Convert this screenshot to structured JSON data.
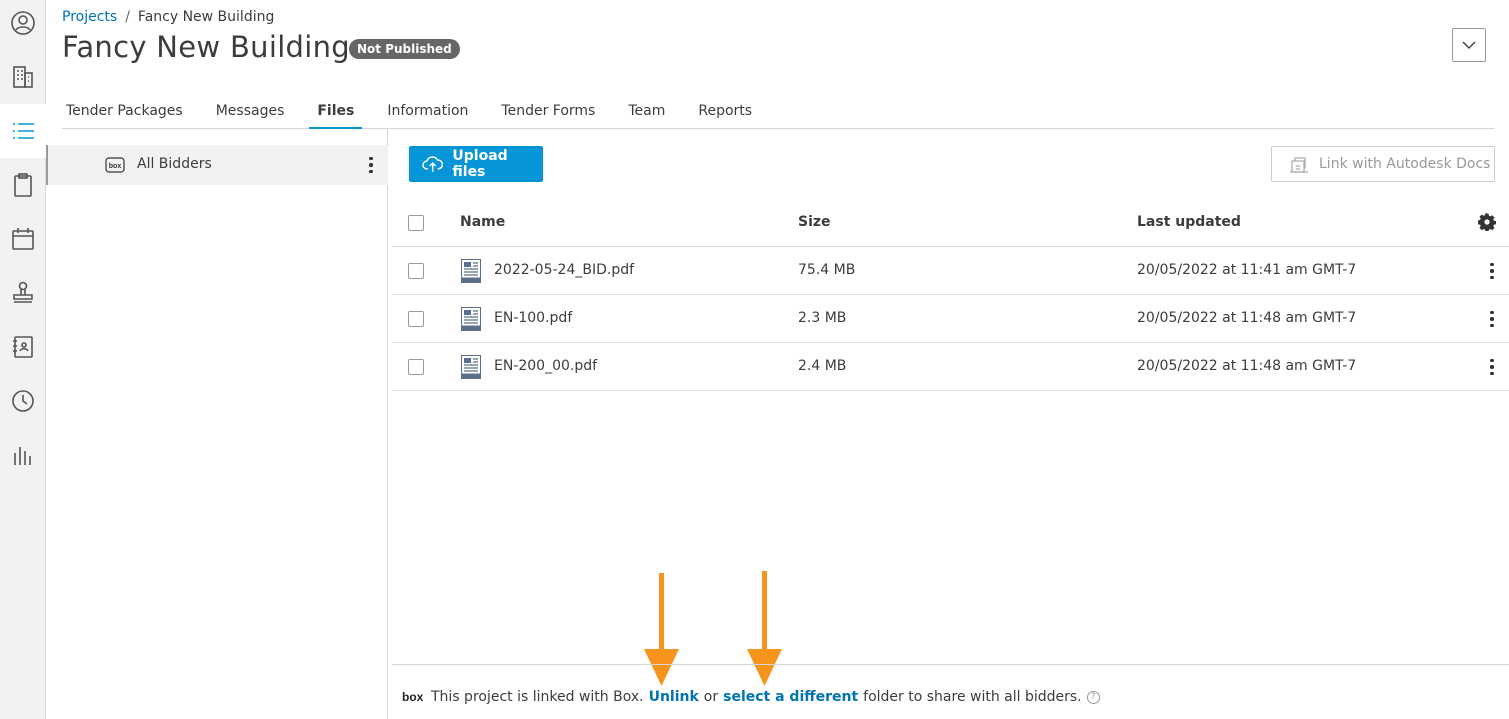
{
  "rail": {
    "items": [
      {
        "icon": "user-circle-icon"
      },
      {
        "icon": "building-icon"
      },
      {
        "icon": "list-icon",
        "active": true
      },
      {
        "icon": "clipboard-icon"
      },
      {
        "icon": "calendar-icon"
      },
      {
        "icon": "stamp-icon"
      },
      {
        "icon": "address-book-icon"
      },
      {
        "icon": "clock-icon"
      },
      {
        "icon": "bar-chart-icon"
      }
    ]
  },
  "breadcrumb": {
    "root": "Projects",
    "separator": "/",
    "current": "Fancy New Building"
  },
  "page": {
    "title": "Fancy New Building",
    "status": "Not Published"
  },
  "tabs": [
    "Tender Packages",
    "Messages",
    "Files",
    "Information",
    "Tender Forms",
    "Team",
    "Reports"
  ],
  "active_tab": "Files",
  "folders": [
    {
      "label": "All Bidders",
      "icon": "box-icon"
    }
  ],
  "toolbar": {
    "upload_label": "Upload files",
    "link_label": "Link with Autodesk Docs"
  },
  "table": {
    "headers": {
      "name": "Name",
      "size": "Size",
      "updated": "Last updated"
    },
    "rows": [
      {
        "name": "2022-05-24_BID.pdf",
        "size": "75.4 MB",
        "updated": "20/05/2022 at 11:41 am GMT-7"
      },
      {
        "name": "EN-100.pdf",
        "size": "2.3 MB",
        "updated": "20/05/2022 at 11:48 am GMT-7"
      },
      {
        "name": "EN-200_00.pdf",
        "size": "2.4 MB",
        "updated": "20/05/2022 at 11:48 am GMT-7"
      }
    ]
  },
  "footer": {
    "text1": "This project is linked with Box.",
    "unlink": "Unlink",
    "text2": "or",
    "select": "select a different",
    "text3": "folder to share with all bidders.",
    "help": "?"
  },
  "colors": {
    "accent": "#0696d7",
    "link": "#0073b5",
    "annotation_arrow": "#f7941d",
    "badge": "#666666"
  }
}
